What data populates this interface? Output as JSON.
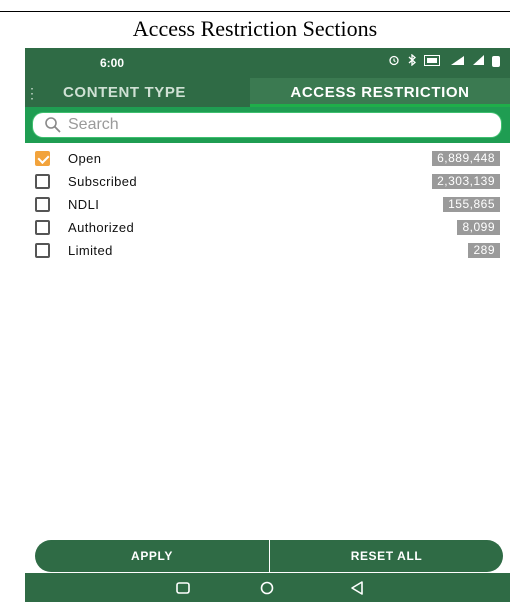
{
  "caption": "Access Restriction Sections",
  "status_bar": {
    "time": "6:00",
    "icons": [
      "alarm-icon",
      "bluetooth-icon",
      "volte-icon",
      "signal-4g-icon",
      "signal-icon",
      "battery-icon"
    ]
  },
  "tabs": [
    {
      "label": "CONTENT TYPE",
      "active": false
    },
    {
      "label": "ACCESS RESTRICTION",
      "active": true
    }
  ],
  "search": {
    "placeholder": "Search",
    "value": ""
  },
  "filters": [
    {
      "label": "Open",
      "count": "6,889,448",
      "checked": true
    },
    {
      "label": "Subscribed",
      "count": "2,303,139",
      "checked": false
    },
    {
      "label": "NDLI",
      "count": "155,865",
      "checked": false
    },
    {
      "label": "Authorized",
      "count": "8,099",
      "checked": false
    },
    {
      "label": "Limited",
      "count": "289",
      "checked": false
    }
  ],
  "actions": {
    "apply_label": "APPLY",
    "reset_label": "RESET ALL"
  },
  "colors": {
    "primary": "#2f6b45",
    "search_bar": "#1f9d52",
    "checkbox_checked": "#f2a33c",
    "count_badge": "#9a9a9a"
  },
  "nav_bar": {
    "icons": [
      "recents-icon",
      "home-icon",
      "back-icon"
    ]
  }
}
